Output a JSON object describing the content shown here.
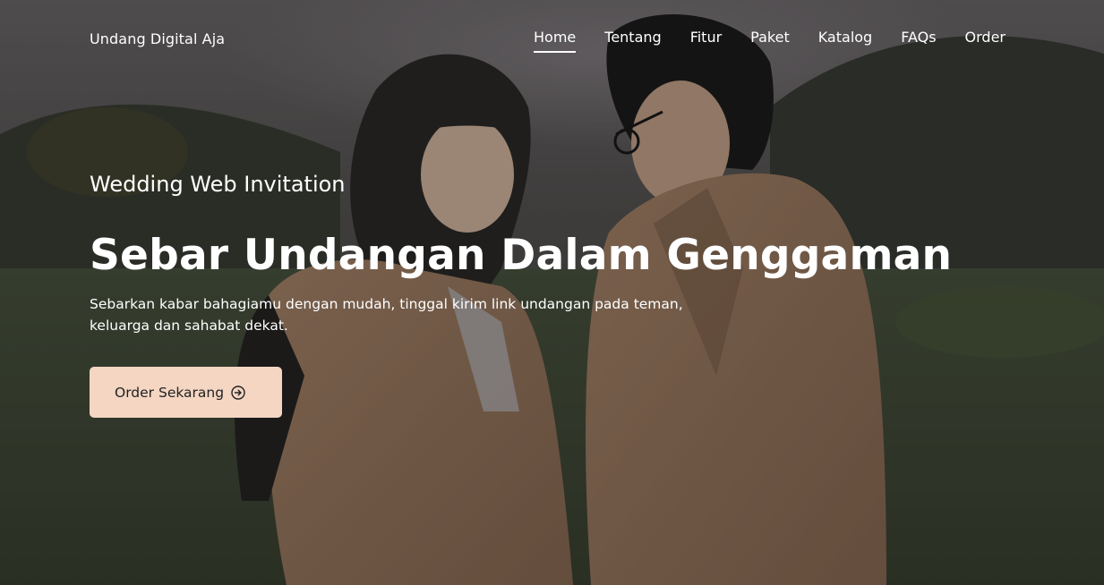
{
  "brand": {
    "name": "Undang Digital Aja"
  },
  "nav": {
    "items": [
      {
        "label": "Home",
        "active": true
      },
      {
        "label": "Tentang",
        "active": false
      },
      {
        "label": "Fitur",
        "active": false
      },
      {
        "label": "Paket",
        "active": false
      },
      {
        "label": "Katalog",
        "active": false
      },
      {
        "label": "FAQs",
        "active": false
      },
      {
        "label": "Order",
        "active": false
      }
    ]
  },
  "hero": {
    "eyebrow": "Wedding Web Invitation",
    "headline": "Sebar Undangan Dalam Genggaman",
    "subtitle": "Sebarkan kabar bahagiamu dengan mudah, tinggal kirim link undangan pada teman, keluarga dan sahabat dekat.",
    "cta_label": "Order Sekarang",
    "cta_icon": "arrow-right-circle-icon"
  },
  "colors": {
    "cta_background": "#f4d6c3",
    "cta_text": "#222222",
    "text": "#ffffff"
  }
}
